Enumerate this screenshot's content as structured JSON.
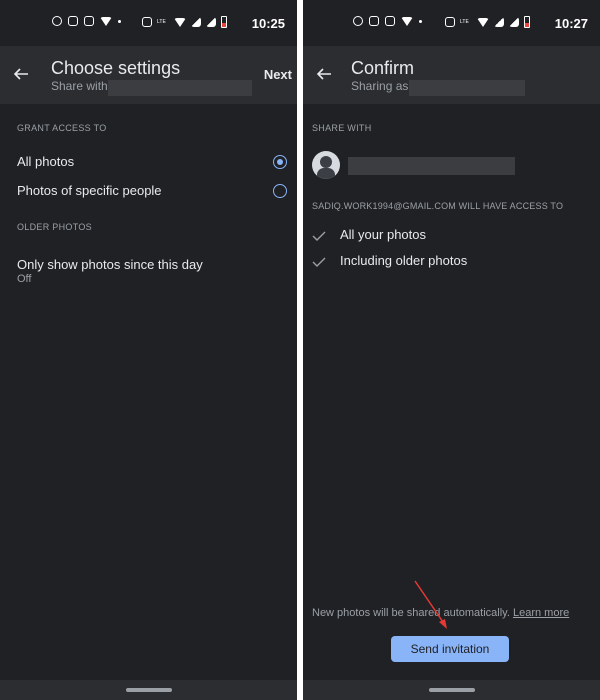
{
  "left_screen": {
    "status": {
      "time": "10:25"
    },
    "appbar": {
      "title": "Choose settings",
      "subtitle": "Share with",
      "next_label": "Next"
    },
    "grant_access": {
      "section_label": "GRANT ACCESS TO",
      "options": [
        {
          "label": "All photos",
          "selected": true
        },
        {
          "label": "Photos of specific people",
          "selected": false
        }
      ]
    },
    "older_photos": {
      "section_label": "OLDER PHOTOS",
      "setting_title": "Only show photos since this day",
      "setting_value": "Off"
    }
  },
  "right_screen": {
    "status": {
      "time": "10:27"
    },
    "appbar": {
      "title": "Confirm",
      "subtitle": "Sharing as"
    },
    "share_with": {
      "section_label": "SHARE WITH"
    },
    "access": {
      "label": "SADIQ.WORK1994@GMAIL.COM WILL HAVE ACCESS TO",
      "items": [
        "All your photos",
        "Including older photos"
      ]
    },
    "footer": {
      "note": "New photos will be shared automatically.",
      "link_label": "Learn more",
      "send_label": "Send invitation"
    }
  },
  "colors": {
    "background": "#202124",
    "appbar": "#2c2d30",
    "accent": "#8ab4f8",
    "annotation_arrow": "#e53935"
  },
  "icons": {
    "status_left": [
      "whatsapp-icon",
      "instagram-icon",
      "instagram-icon",
      "tiktok-icon"
    ],
    "status_right": [
      "vibrate-icon",
      "volte-icon",
      "wifi-icon",
      "signal-icon",
      "battery-icon"
    ]
  }
}
